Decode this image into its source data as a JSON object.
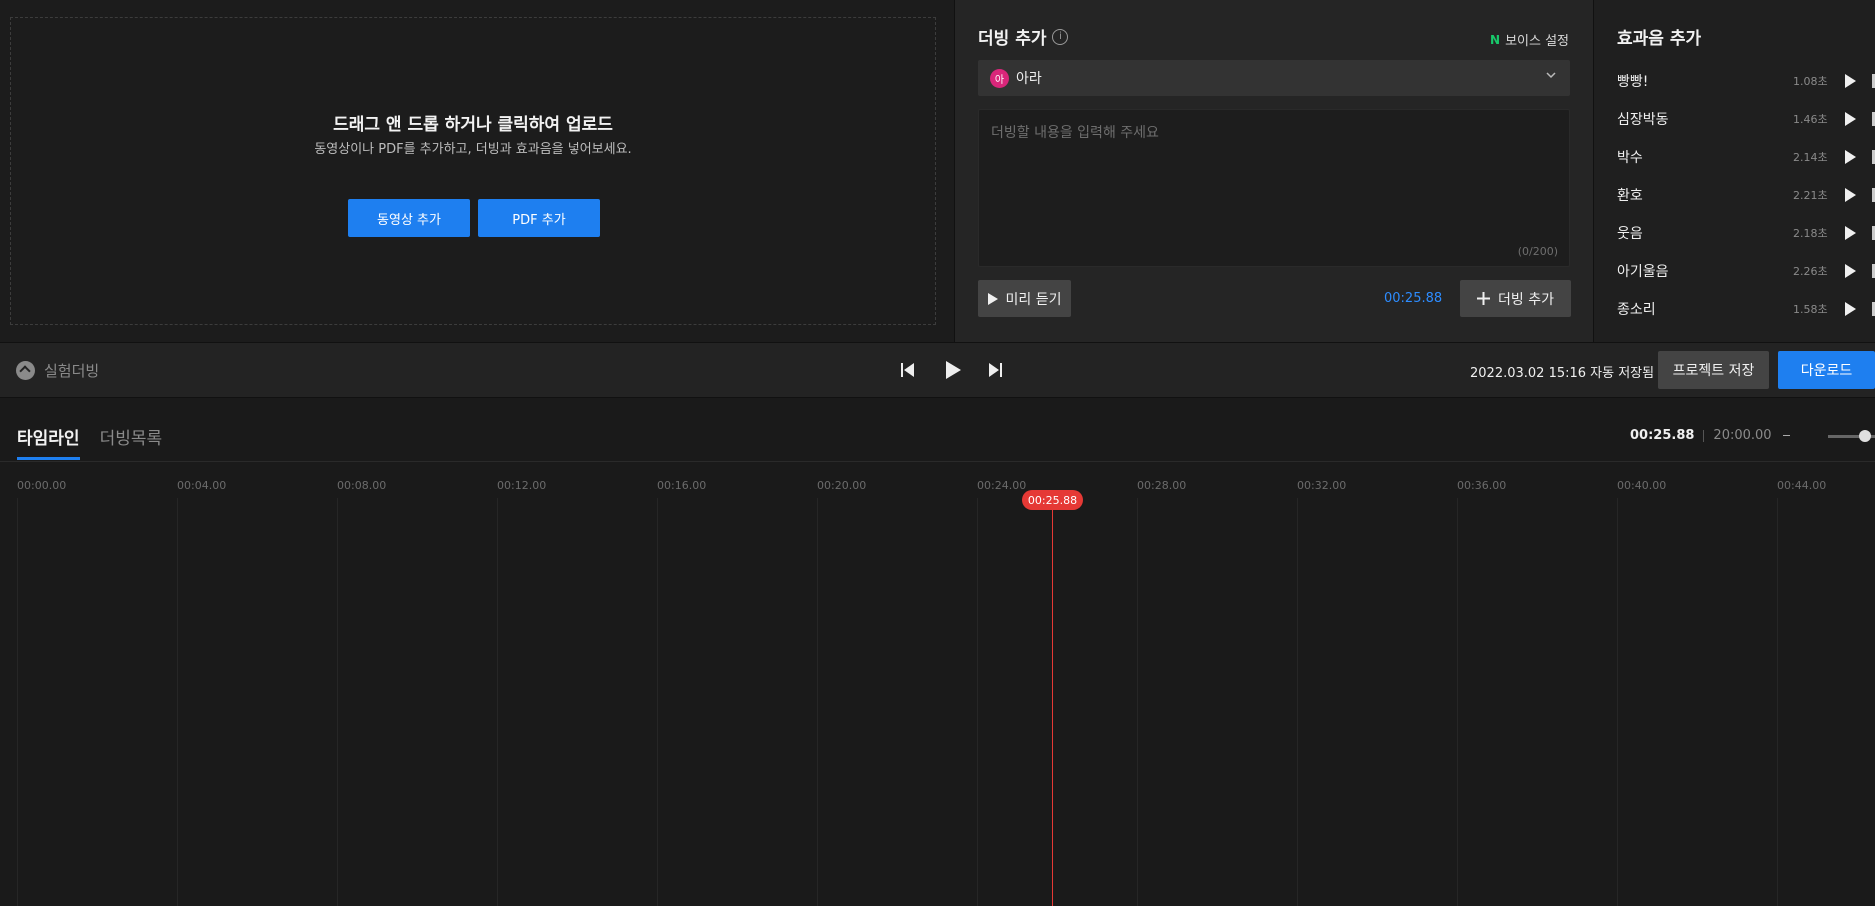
{
  "upload": {
    "title": "드래그 앤 드롭 하거나 클릭하여 업로드",
    "subtitle": "동영상이나 PDF를 추가하고, 더빙과 효과음을 넣어보세요.",
    "add_video_label": "동영상 추가",
    "add_pdf_label": "PDF 추가"
  },
  "dubbing": {
    "title": "더빙 추가",
    "info_icon": "i",
    "voice_setting_icon": "N",
    "voice_setting_label": "보이스 설정",
    "voice": {
      "avatar": "아",
      "name": "아라",
      "avatar_color": "#d9267a"
    },
    "text_placeholder": "더빙할 내용을 입력해 주세요",
    "char_count": "(0/200)",
    "preview_label": "미리 듣기",
    "current_time": "00:25.88",
    "add_button_label": "더빙 추가"
  },
  "sfx": {
    "title": "효과음 추가",
    "items": [
      {
        "name": "빵빵!",
        "duration": "1.08초"
      },
      {
        "name": "심장박동",
        "duration": "1.46초"
      },
      {
        "name": "박수",
        "duration": "2.14초"
      },
      {
        "name": "환호",
        "duration": "2.21초"
      },
      {
        "name": "웃음",
        "duration": "2.18초"
      },
      {
        "name": "아기울음",
        "duration": "2.26초"
      },
      {
        "name": "종소리",
        "duration": "1.58초"
      }
    ]
  },
  "control_bar": {
    "collapse_label": "실험더빙",
    "autosave_text": "2022.03.02 15:16 자동 저장됨",
    "save_label": "프로젝트 저장",
    "download_label": "다운로드"
  },
  "timeline": {
    "tabs": [
      {
        "label": "타임라인",
        "active": true
      },
      {
        "label": "더빙목록",
        "active": false
      }
    ],
    "current_time": "00:25.88",
    "total_time": "20:00.00",
    "zoom_level": 1.0,
    "ticks": [
      "00:00.00",
      "00:04.00",
      "00:08.00",
      "00:12.00",
      "00:16.00",
      "00:20.00",
      "00:24.00",
      "00:28.00",
      "00:32.00",
      "00:36.00",
      "00:40.00",
      "00:44.00"
    ],
    "playhead_label": "00:25.88",
    "accent_color": "#1e7ff0",
    "playhead_color": "#e53935"
  }
}
